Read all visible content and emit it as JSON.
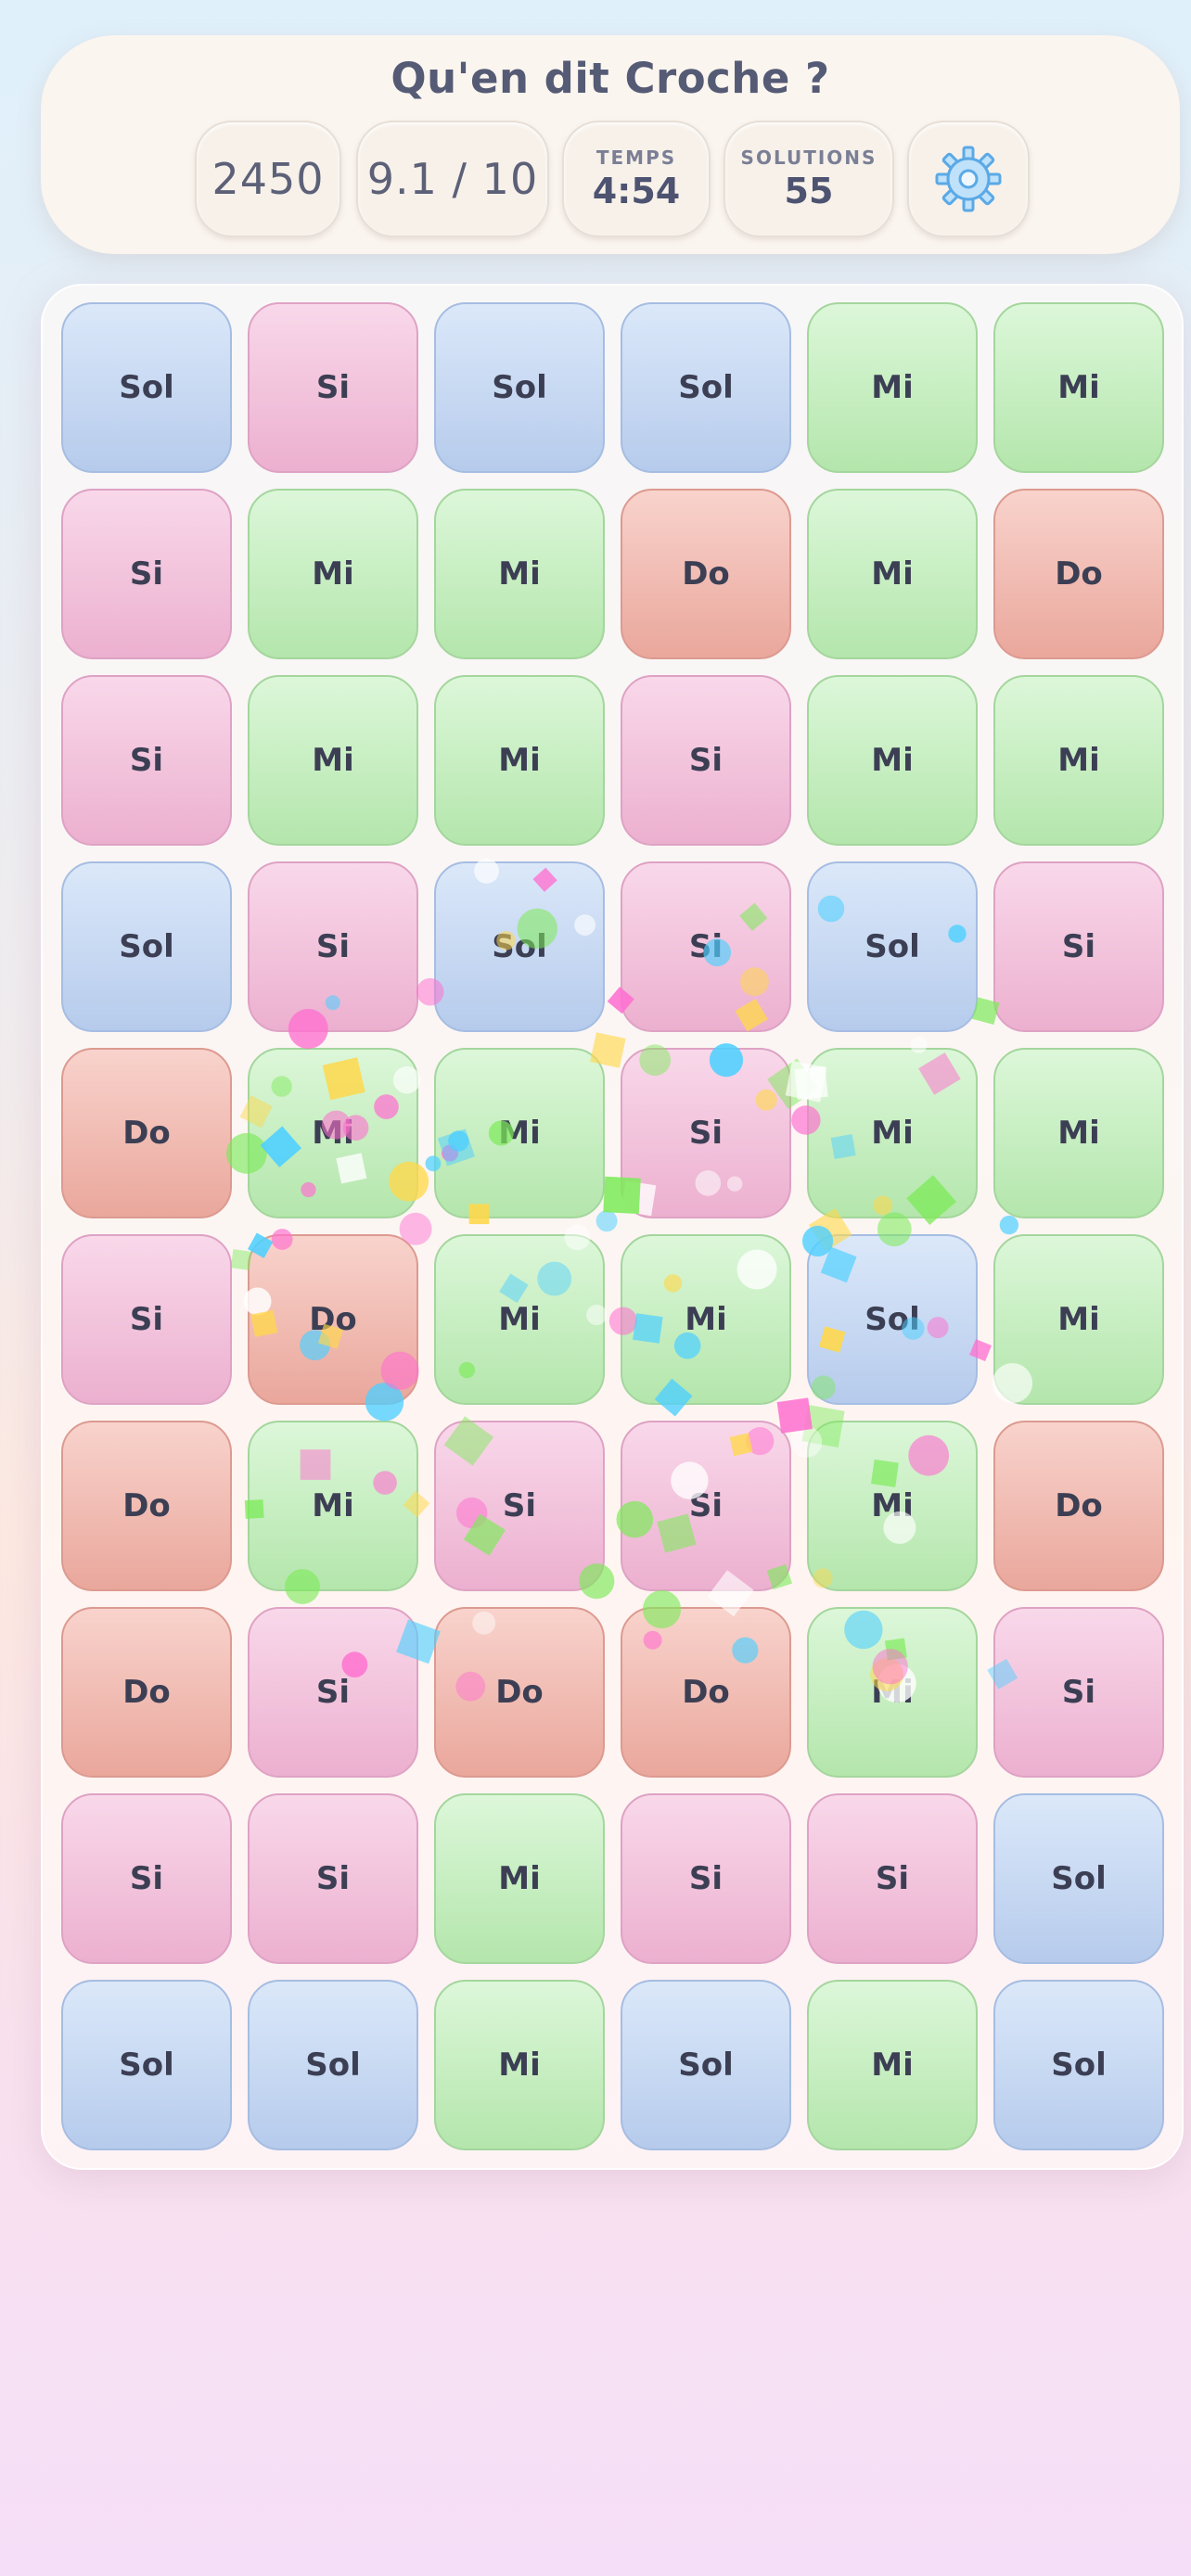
{
  "header": {
    "title": "Qu'en dit Croche ?",
    "score": "2450",
    "rating": "9.1 / 10",
    "time_label": "TEMPS",
    "time_value": "4:54",
    "solutions_label": "SOLUTIONS",
    "solutions_value": "55",
    "settings_icon": "gear-icon"
  },
  "board": {
    "rows": [
      [
        "Sol",
        "Si",
        "Sol",
        "Sol",
        "Mi",
        "Mi"
      ],
      [
        "Si",
        "Mi",
        "Mi",
        "Do",
        "Mi",
        "Do"
      ],
      [
        "Si",
        "Mi",
        "Mi",
        "Si",
        "Mi",
        "Mi"
      ],
      [
        "Sol",
        "Si",
        "Sol",
        "Si",
        "Sol",
        "Si"
      ],
      [
        "Do",
        "Mi",
        "Mi",
        "Si",
        "Mi",
        "Mi"
      ],
      [
        "Si",
        "Do",
        "Mi",
        "Mi",
        "Sol",
        "Mi"
      ],
      [
        "Do",
        "Mi",
        "Si",
        "Si",
        "Mi",
        "Do"
      ],
      [
        "Do",
        "Si",
        "Do",
        "Do",
        "Mi",
        "Si"
      ],
      [
        "Si",
        "Si",
        "Mi",
        "Si",
        "Si",
        "Sol"
      ],
      [
        "Sol",
        "Sol",
        "Mi",
        "Sol",
        "Mi",
        "Sol"
      ]
    ]
  },
  "colors": {
    "Sol": "#b6cbec",
    "Si": "#ecb0cf",
    "Mi": "#b4e6ac",
    "Do": "#eaa79c",
    "confetti": [
      "#ff6fd0",
      "#4fd0ff",
      "#7dea5a",
      "#ffd84a",
      "#ffffff"
    ]
  }
}
